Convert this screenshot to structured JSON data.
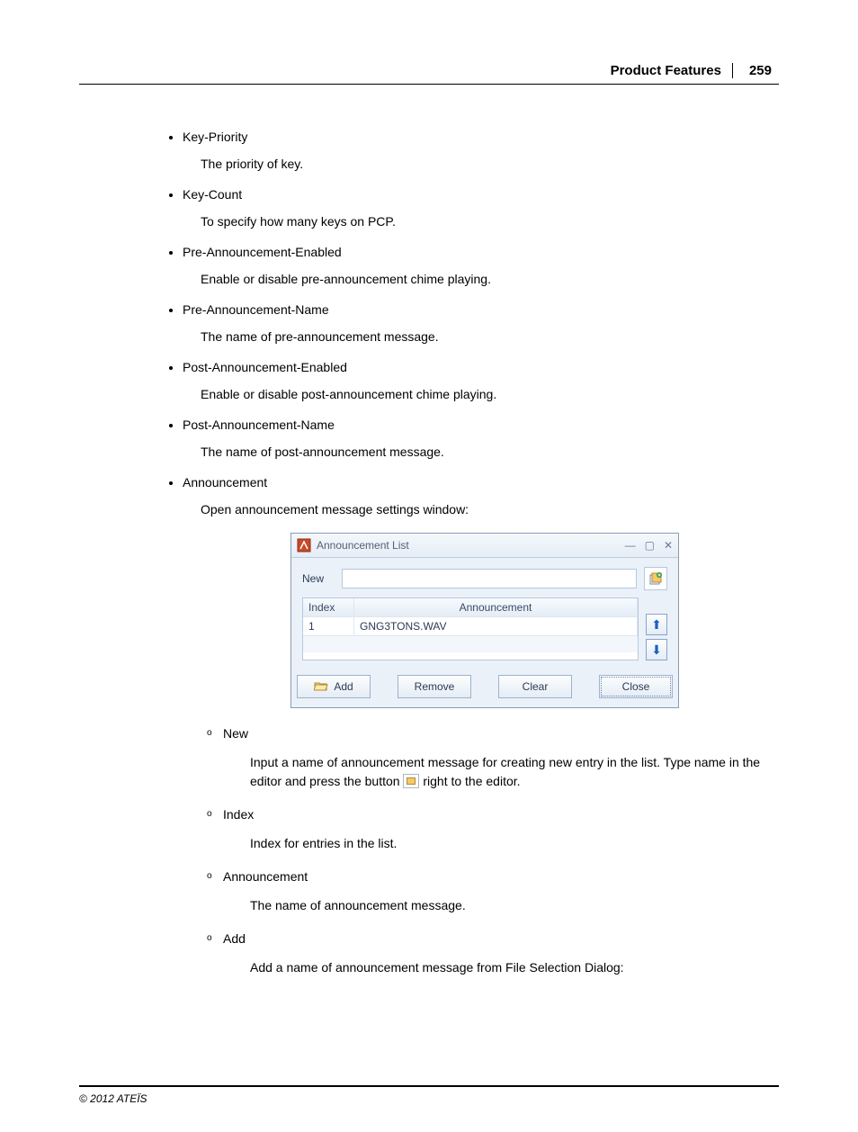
{
  "header": {
    "title": "Product Features",
    "page_number": "259"
  },
  "items": [
    {
      "title": "Key-Priority",
      "desc": "The priority of key."
    },
    {
      "title": "Key-Count",
      "desc": "To specify how many keys on PCP."
    },
    {
      "title": "Pre-Announcement-Enabled",
      "desc": "Enable or disable pre-announcement chime playing."
    },
    {
      "title": "Pre-Announcement-Name",
      "desc": "The name of pre-announcement message."
    },
    {
      "title": "Post-Announcement-Enabled",
      "desc": "Enable or disable post-announcement chime playing."
    },
    {
      "title": "Post-Announcement-Name",
      "desc": "The name of post-announcement message."
    },
    {
      "title": "Announcement",
      "desc": "Open announcement message settings window:"
    }
  ],
  "dialog": {
    "title": "Announcement List",
    "new_label": "New",
    "table": {
      "col_index": "Index",
      "col_announcement": "Announcement",
      "rows": [
        {
          "index": "1",
          "announcement": "GNG3TONS.WAV"
        }
      ]
    },
    "buttons": {
      "add": "Add",
      "remove": "Remove",
      "clear": "Clear",
      "close": "Close"
    }
  },
  "subitems": [
    {
      "title": "New",
      "desc_1": "Input a name of announcement message for creating new entry in the list. Type name in the editor and press the button",
      "desc_2": "right to the editor."
    },
    {
      "title": "Index",
      "desc_1": "Index for entries in the list."
    },
    {
      "title": "Announcement",
      "desc_1": "The name of announcement message."
    },
    {
      "title": "Add",
      "desc_1": "Add a name of announcement message from File Selection Dialog:"
    }
  ],
  "footer": {
    "copyright": "© 2012 ATEÏS"
  }
}
